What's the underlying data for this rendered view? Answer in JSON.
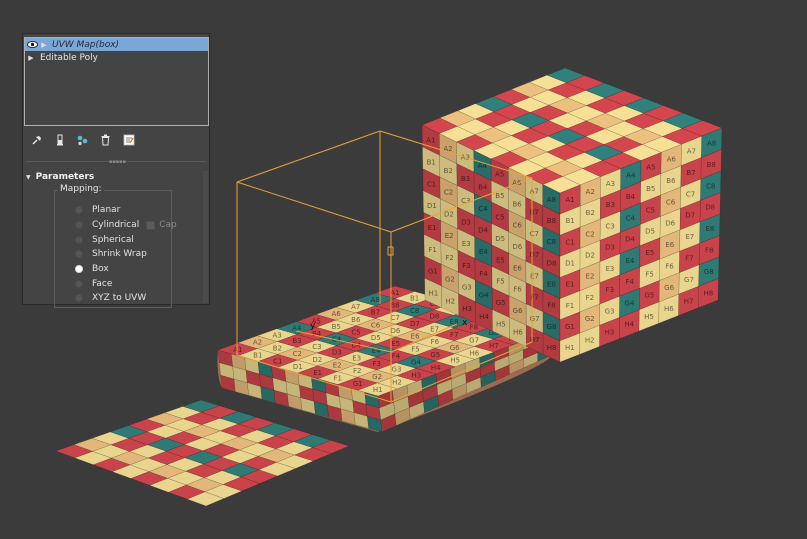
{
  "modifier_stack": {
    "items": [
      {
        "label": "UVW Map(box)",
        "selected": true,
        "visible_icon": "eye-icon",
        "expand_icon": "triangle-right-icon"
      },
      {
        "label": "Editable Poly",
        "selected": false,
        "expand_icon": "triangle-right-icon"
      }
    ]
  },
  "toolbar": {
    "icons": [
      "pin-stack-icon",
      "show-end-result-icon",
      "make-unique-icon",
      "remove-modifier-icon",
      "configure-modifier-sets-icon"
    ]
  },
  "parameters": {
    "title": "Parameters",
    "mapping_label": "Mapping:",
    "options": [
      "Planar",
      "Cylindrical",
      "Spherical",
      "Shrink Wrap",
      "Box",
      "Face",
      "XYZ to UVW"
    ],
    "selected": "Box",
    "cap_label": "Cap"
  },
  "viewport": {
    "axis_labels": [
      "y",
      "x"
    ],
    "gizmo_color": "#e8a23a",
    "checker_colors": [
      "#c9434a",
      "#2f7a75",
      "#e9d58e",
      "#e3b77a"
    ],
    "grid_letters": [
      "A",
      "B",
      "C",
      "D",
      "E",
      "F",
      "G",
      "H"
    ],
    "grid_numbers": [
      "1",
      "2",
      "3",
      "4",
      "5",
      "6",
      "7",
      "8"
    ]
  }
}
